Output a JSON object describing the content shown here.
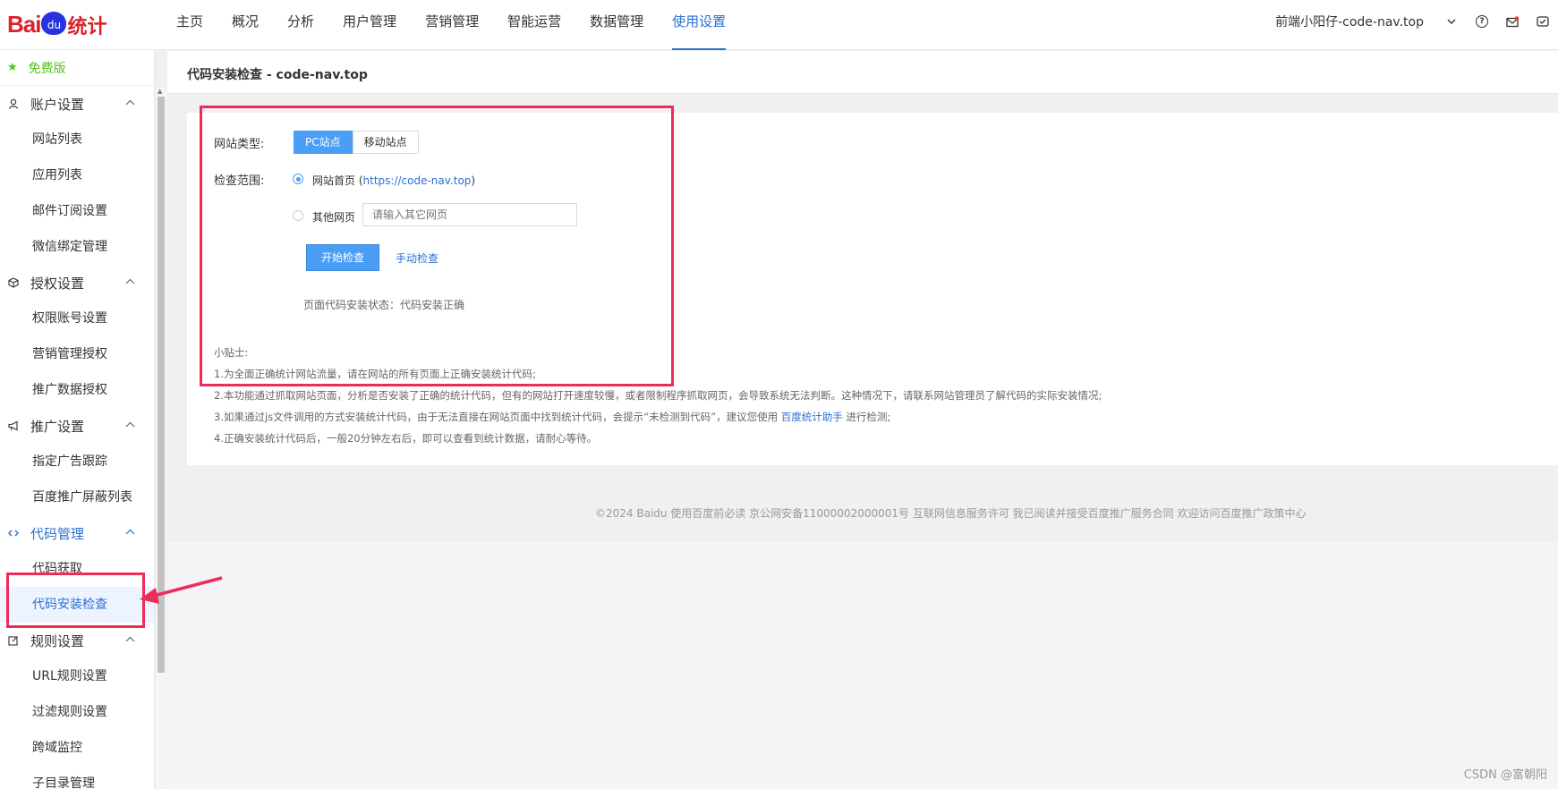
{
  "logo": {
    "text": "Bai",
    "paw": "du",
    "cn": "统计"
  },
  "nav": {
    "items": [
      "主页",
      "概况",
      "分析",
      "用户管理",
      "营销管理",
      "智能运营",
      "数据管理",
      "使用设置"
    ]
  },
  "top_right": {
    "site_name": "前端小阳仔-code-nav.top",
    "icons": [
      "chevron-down-icon",
      "help-icon",
      "mail-icon",
      "message-icon"
    ]
  },
  "sidebar": {
    "free_label": "免费版",
    "groups": [
      {
        "label": "账户设置",
        "items": [
          "网站列表",
          "应用列表",
          "邮件订阅设置",
          "微信绑定管理"
        ]
      },
      {
        "label": "授权设置",
        "items": [
          "权限账号设置",
          "营销管理授权",
          "推广数据授权"
        ]
      },
      {
        "label": "推广设置",
        "items": [
          "指定广告跟踪",
          "百度推广屏蔽列表"
        ]
      },
      {
        "label": "代码管理",
        "items": [
          "代码获取",
          "代码安装检查"
        ]
      },
      {
        "label": "规则设置",
        "items": [
          "URL规则设置",
          "过滤规则设置",
          "跨域监控",
          "子目录管理"
        ]
      }
    ]
  },
  "page": {
    "title": "代码安装检查 - code-nav.top",
    "site_type_label": "网站类型:",
    "site_types": [
      "PC站点",
      "移动站点"
    ],
    "scope_label": "检查范围:",
    "homepage_label": "网站首页",
    "homepage_url": "https://code-nav.top",
    "other_label": "其他网页",
    "other_placeholder": "请输入其它网页",
    "start_button": "开始检查",
    "manual_button": "手动检查",
    "status": "页面代码安装状态：代码安装正确",
    "tips_title": "小贴士:",
    "tip1": "1.为全面正确统计网站流量，请在网站的所有页面上正确安装统计代码;",
    "tip2": "2.本功能通过抓取网站页面，分析是否安装了正确的统计代码，但有的网站打开速度较慢，或者限制程序抓取网页，会导致系统无法判断。这种情况下，请联系网站管理员了解代码的实际安装情况;",
    "tip3_pre": "3.如果通过js文件调用的方式安装统计代码，由于无法直接在网站页面中找到统计代码，会提示“未检测到代码”，建议您使用",
    "tip3_link": "百度统计助手",
    "tip3_post": "进行检测;",
    "tip4": "4.正确安装统计代码后，一般20分钟左右后，即可以查看到统计数据，请耐心等待。"
  },
  "footer": {
    "text": "©2024 Baidu 使用百度前必读 京公网安备11000002000001号 互联网信息服务许可 我已阅读并接受百度推广服务合同 欢迎访问百度推广政策中心"
  },
  "watermark": "CSDN @富朝阳",
  "colors": {
    "accent": "#2c6fd1",
    "button": "#4a9ef6",
    "annotation": "#ee2c5a",
    "free": "#52c41a",
    "logo": "#d8232a"
  }
}
